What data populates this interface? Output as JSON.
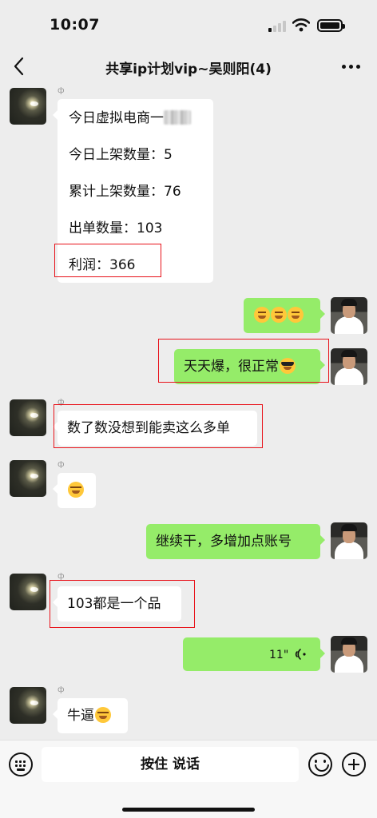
{
  "status": {
    "time": "10:07"
  },
  "nav": {
    "title": "共享ip计划vip~吴则阳(4)"
  },
  "messages": [
    {
      "side": "in",
      "tag": "ф",
      "lines": [
        "今日虚拟电商一",
        "今日上架数量：5",
        "累计上架数量：76",
        "出单数量：103",
        "利润：366"
      ]
    },
    {
      "side": "out",
      "emoji": [
        "thinking-face",
        "thinking-face",
        "thinking-face"
      ]
    },
    {
      "side": "out",
      "text": "天天爆，很正常",
      "emoji": [
        "sunglasses-face"
      ]
    },
    {
      "side": "in",
      "tag": "ф",
      "text": "数了数没想到能卖这么多单"
    },
    {
      "side": "in",
      "tag": "ф",
      "emoji": [
        "tears-of-joy-face"
      ]
    },
    {
      "side": "out",
      "text": "继续干，多增加点账号"
    },
    {
      "side": "in",
      "tag": "ф",
      "text": "103都是一个品"
    },
    {
      "side": "out",
      "voice_duration": "11\""
    },
    {
      "side": "in",
      "tag": "ф",
      "text": "牛逼",
      "emoji": [
        "tears-of-joy-face"
      ]
    }
  ],
  "input": {
    "hold_to_talk": "按住 说话"
  },
  "colors": {
    "outgoing_bubble": "#95ec69",
    "incoming_bubble": "#ffffff",
    "highlight": "#e8121a",
    "background": "#ededed"
  }
}
